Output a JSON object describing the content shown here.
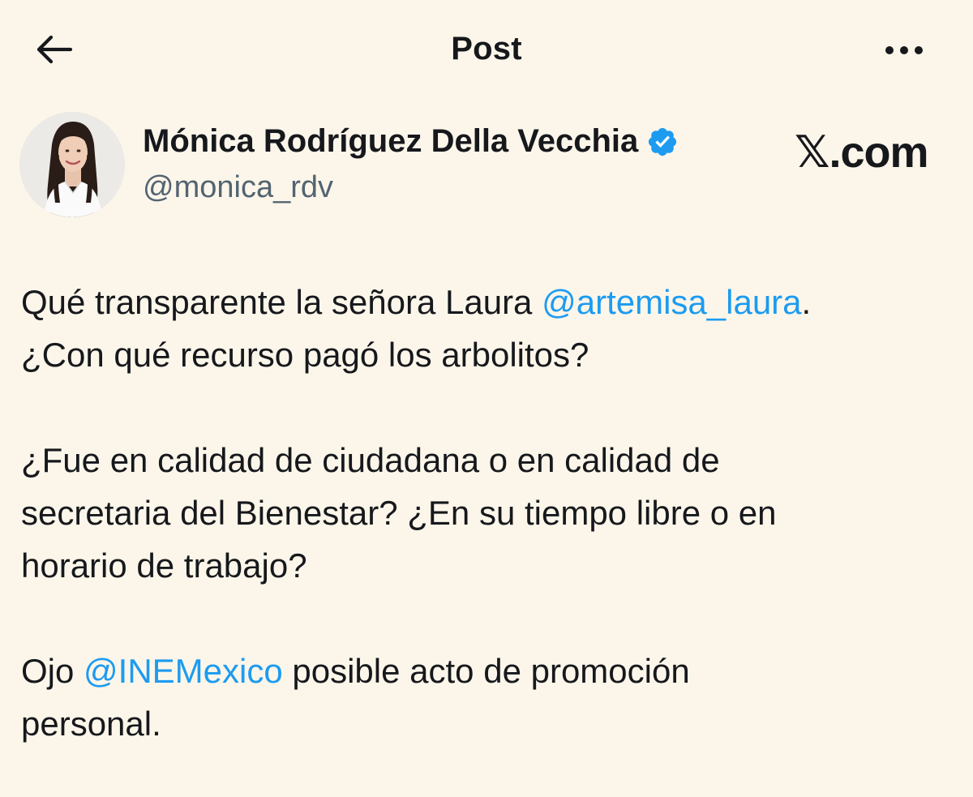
{
  "header": {
    "back_icon": "arrow-left-icon",
    "title": "Post",
    "more_icon": "more-horizontal-icon"
  },
  "author": {
    "name": "Mónica Rodríguez Della Vecchia",
    "handle": "@monica_rdv",
    "verified": true,
    "verified_icon": "verified-badge-icon",
    "verified_color": "#1d9bf0"
  },
  "watermark": {
    "x": "𝕏",
    "suffix": ".com"
  },
  "post": {
    "p1_text_a": "Qué transparente la señora Laura ",
    "p1_mention": "@artemisa_laura",
    "p1_text_b": ".",
    "p1_line2": "¿Con qué recurso pagó los arbolitos?",
    "p2_line1": "¿Fue en calidad de ciudadana o en calidad de",
    "p2_line2": "secretaria del Bienestar? ¿En su tiempo libre o en",
    "p2_line3": "horario de trabajo?",
    "p3_text_a": "Ojo ",
    "p3_mention": "@INEMexico",
    "p3_text_b": " posible acto de promoción",
    "p3_line2": "personal."
  },
  "colors": {
    "background": "#fcf6ea",
    "text": "#16181c",
    "secondary_text": "#536471",
    "link": "#1d9bf0"
  }
}
